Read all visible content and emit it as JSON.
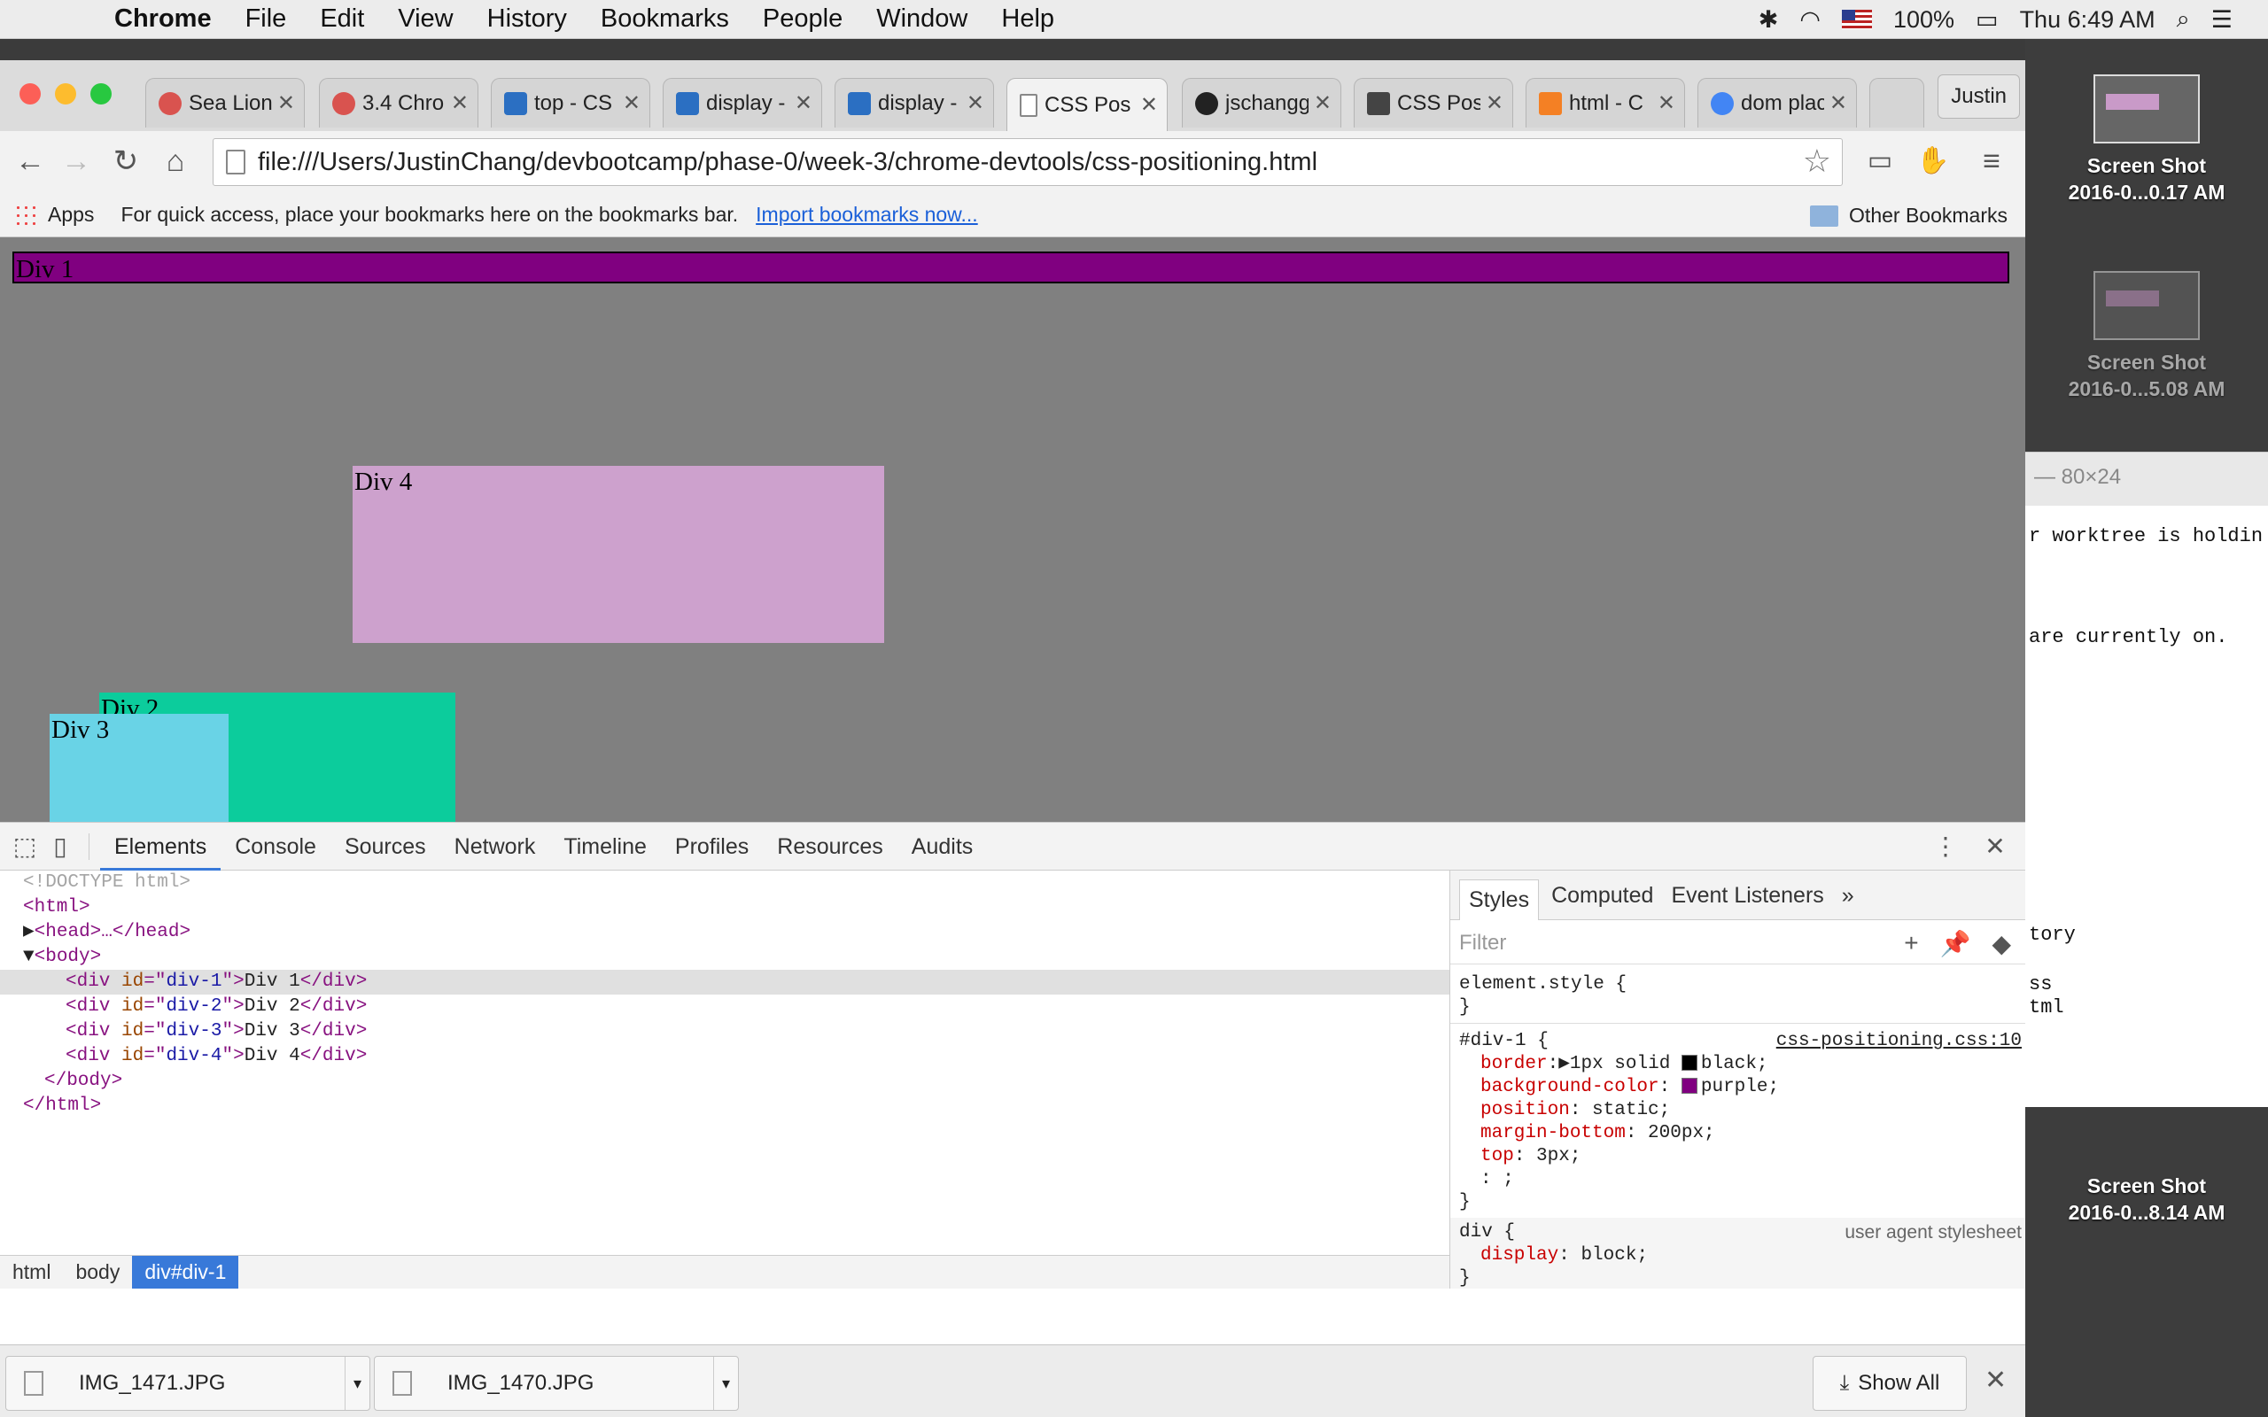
{
  "menubar": {
    "app": "Chrome",
    "items": [
      "File",
      "Edit",
      "View",
      "History",
      "Bookmarks",
      "People",
      "Window",
      "Help"
    ],
    "battery": "100%",
    "clock": "Thu 6:49 AM"
  },
  "tabs": [
    {
      "title": "Sea Lion",
      "icon": "sea-lion-icon",
      "color": "#d9534f"
    },
    {
      "title": "3.4 Chro",
      "icon": "sea-lion-icon",
      "color": "#d9534f"
    },
    {
      "title": "top - CS",
      "icon": "mdn-icon",
      "color": "#2b6fc2"
    },
    {
      "title": "display -",
      "icon": "mdn-icon",
      "color": "#2b6fc2"
    },
    {
      "title": "display -",
      "icon": "mdn-icon",
      "color": "#2b6fc2"
    },
    {
      "title": "CSS Pos",
      "icon": "document-icon",
      "color": "#888888"
    },
    {
      "title": "jschangg",
      "icon": "github-icon",
      "color": "#222222"
    },
    {
      "title": "CSS Pos",
      "icon": "codecademy-icon",
      "color": "#444444"
    },
    {
      "title": "html - C",
      "icon": "stackoverflow-icon",
      "color": "#f48024"
    },
    {
      "title": "dom plac",
      "icon": "google-icon",
      "color": "#4285f4"
    }
  ],
  "profile": "Justin",
  "url": "file:///Users/JustinChang/devbootcamp/phase-0/week-3/chrome-devtools/css-positioning.html",
  "bookmarks": {
    "apps": "Apps",
    "prompt": "For quick access, place your bookmarks here on the bookmarks bar.",
    "import_link": "Import bookmarks now...",
    "other": "Other Bookmarks"
  },
  "page": {
    "div1": {
      "label": "Div 1",
      "color": "#800080"
    },
    "div2": {
      "label": "Div 2",
      "color": "#0ccc9c"
    },
    "div3": {
      "label": "Div 3",
      "color": "#69d3e6"
    },
    "div4": {
      "label": "Div 4",
      "color": "#cda1cd"
    }
  },
  "devtools": {
    "tabs": [
      "Elements",
      "Console",
      "Sources",
      "Network",
      "Timeline",
      "Profiles",
      "Resources",
      "Audits"
    ],
    "active_tab": "Elements",
    "dom": {
      "doctype": "<!DOCTYPE html>",
      "html_open": "<html>",
      "head": "<head>…</head>",
      "body_open": "<body>",
      "divs": [
        {
          "id": "div-1",
          "text": "Div 1"
        },
        {
          "id": "div-2",
          "text": "Div 2"
        },
        {
          "id": "div-3",
          "text": "Div 3"
        },
        {
          "id": "div-4",
          "text": "Div 4"
        }
      ],
      "body_close": "</body>",
      "html_close": "</html>"
    },
    "breadcrumb": [
      "html",
      "body",
      "div#div-1"
    ],
    "styles": {
      "tabs": [
        "Styles",
        "Computed",
        "Event Listeners"
      ],
      "filter_placeholder": "Filter",
      "element_style": "element.style {",
      "rule_selector": "#div-1 {",
      "rule_source": "css-positioning.css:10",
      "declarations": [
        {
          "prop": "border",
          "value": "1px solid",
          "swatch": "#000000",
          "after": "black;"
        },
        {
          "prop": "background-color",
          "value": "",
          "swatch": "#800080",
          "after": "purple;"
        },
        {
          "prop": "position",
          "value": "static;"
        },
        {
          "prop": "margin-bottom",
          "value": "200px;"
        },
        {
          "prop": "top",
          "value": "3px;"
        }
      ],
      "editing": ": ;",
      "ua_selector": "div {",
      "ua_source": "user agent stylesheet",
      "ua_prop": "display",
      "ua_value": "block;"
    }
  },
  "downloads": [
    {
      "name": "IMG_1471.JPG"
    },
    {
      "name": "IMG_1470.JPG"
    }
  ],
  "show_all": "Show All",
  "desktop": {
    "shots": [
      {
        "label1": "Screen Shot",
        "label2": "2016-0...0.17 AM"
      },
      {
        "label1": "Screen Shot",
        "label2": "2016-0...5.08 AM"
      },
      {
        "label1": "Screen Shot",
        "label2": "2016-0...8.14 AM"
      }
    ]
  },
  "terminal": {
    "title": "— 80×24",
    "lines": [
      "r worktree is holdin",
      "are currently on.",
      "tory",
      "ss",
      "tml"
    ]
  }
}
